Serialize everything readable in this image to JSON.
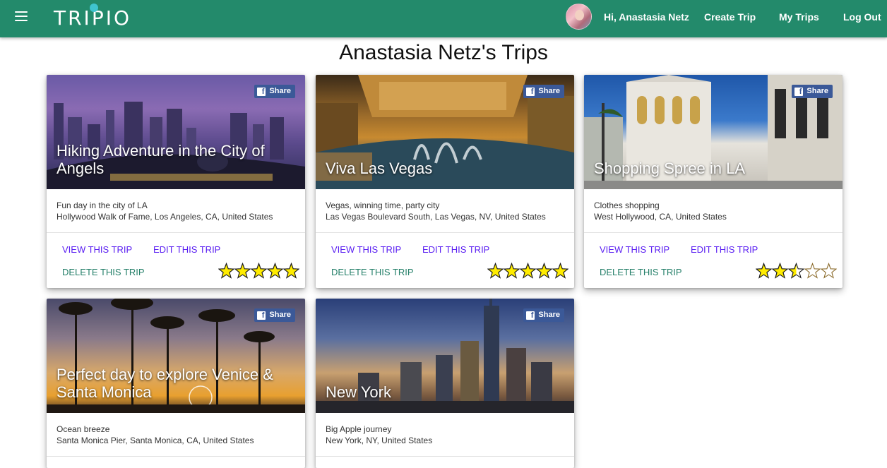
{
  "nav": {
    "logo": "TRIPIO",
    "greeting": "Hi, Anastasia Netz",
    "create_trip": "Create Trip",
    "my_trips": "My Trips",
    "log_out": "Log Out"
  },
  "page": {
    "title": "Anastasia Netz's Trips"
  },
  "share_label": "Share",
  "colors": {
    "navbar": "#238a6b",
    "view_edit": "#5a1ff2",
    "delete": "#26806a",
    "facebook": "#3b5998",
    "star_fill": "#ffec00"
  },
  "trips": [
    {
      "title": "Hiking Adventure in the City of Angels",
      "description": "Fun day in the city of LA",
      "location": "Hollywood Walk of Fame, Los Angeles, CA, United States",
      "view": "VIEW THIS TRIP",
      "edit": "EDIT THIS TRIP",
      "delete": "DELETE THIS TRIP",
      "rating": 5
    },
    {
      "title": "Viva Las Vegas",
      "description": "Vegas, winning time, party city",
      "location": "Las Vegas Boulevard South, Las Vegas, NV, United States",
      "view": "VIEW THIS TRIP",
      "edit": "EDIT THIS TRIP",
      "delete": "DELETE THIS TRIP",
      "rating": 5
    },
    {
      "title": "Shopping Spree in LA",
      "description": "Clothes shopping",
      "location": "West Hollywood, CA, United States",
      "view": "VIEW THIS TRIP",
      "edit": "EDIT THIS TRIP",
      "delete": "DELETE THIS TRIP",
      "rating": 2.5
    },
    {
      "title": "Perfect day to explore Venice & Santa Monica",
      "description": "Ocean breeze",
      "location": "Santa Monica Pier, Santa Monica, CA, United States"
    },
    {
      "title": "New York",
      "description": "Big Apple journey",
      "location": "New York, NY, United States"
    }
  ]
}
